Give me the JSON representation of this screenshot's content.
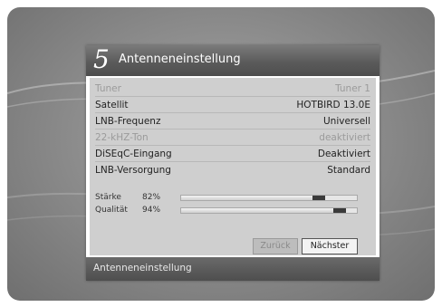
{
  "dialog": {
    "step": "5",
    "title": "Antenneneinstellung"
  },
  "settings": [
    {
      "label": "Tuner",
      "value": "Tuner 1",
      "state": "disabled"
    },
    {
      "label": "Satellit",
      "value": "HOTBIRD 13.0E",
      "state": "enabled"
    },
    {
      "label": "LNB-Frequenz",
      "value": "Universell",
      "state": "enabled"
    },
    {
      "label": "22-kHZ-Ton",
      "value": "deaktiviert",
      "state": "disabled"
    },
    {
      "label": "DiSEqC-Eingang",
      "value": "Deaktiviert",
      "state": "enabled"
    },
    {
      "label": "LNB-Versorgung",
      "value": "Standard",
      "state": "enabled"
    }
  ],
  "signal": {
    "strength": {
      "label": "Stärke",
      "percent_text": "82%",
      "value": 82
    },
    "quality": {
      "label": "Qualität",
      "percent_text": "94%",
      "value": 94
    }
  },
  "buttons": {
    "back": "Zurück",
    "next": "Nächster"
  },
  "footer": {
    "text": "Antenneneinstellung"
  }
}
